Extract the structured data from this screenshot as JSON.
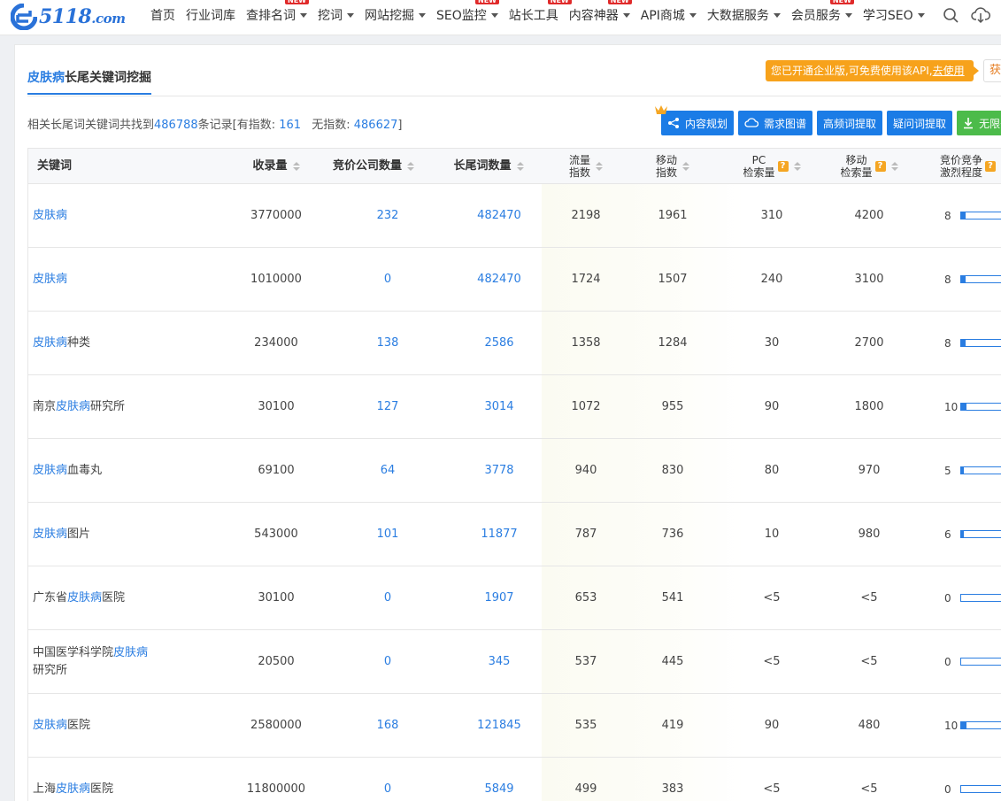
{
  "brand": {
    "logo_text": "5118",
    "logo_suffix": ".com"
  },
  "nav": {
    "items": [
      {
        "label": "首页",
        "caret": false,
        "badge": ""
      },
      {
        "label": "行业词库",
        "caret": false,
        "badge": ""
      },
      {
        "label": "查排名词",
        "caret": true,
        "badge": "NEW"
      },
      {
        "label": "挖词",
        "caret": true,
        "badge": ""
      },
      {
        "label": "网站挖掘",
        "caret": true,
        "badge": ""
      },
      {
        "label": "SEO监控",
        "caret": true,
        "badge": "NEW"
      },
      {
        "label": "站长工具",
        "caret": false,
        "badge": "NEW"
      },
      {
        "label": "内容神器",
        "caret": true,
        "badge": "NEW"
      },
      {
        "label": "API商城",
        "caret": true,
        "badge": ""
      },
      {
        "label": "大数据服务",
        "caret": true,
        "badge": ""
      },
      {
        "label": "会员服务",
        "caret": true,
        "badge": "NEW"
      },
      {
        "label": "学习SEO",
        "caret": true,
        "badge": ""
      }
    ],
    "icons": [
      "search-icon",
      "cloud-download-icon"
    ]
  },
  "tab": {
    "highlight": "皮肤病",
    "rest": "长尾关键词挖掘"
  },
  "promo": {
    "text": "您已开通企业版,可免费使用该API,",
    "link": "去使用"
  },
  "get_button": "获取",
  "summary": {
    "prefix": "相关长尾词关键词共找到",
    "total": "486788",
    "mid": "条记录[有指数:",
    "with_index": "161",
    "mid2": "无指数:",
    "without_index": "486627",
    "suffix": "]"
  },
  "actions": [
    {
      "label": "内容规划",
      "icon": "share-nodes-icon",
      "color": "#1b7ce6"
    },
    {
      "label": "需求图谱",
      "icon": "cloud-icon",
      "color": "#1b7ce6"
    },
    {
      "label": "高频词提取",
      "icon": "",
      "color": "#1b7ce6"
    },
    {
      "label": "疑问词提取",
      "icon": "",
      "color": "#1b7ce6"
    },
    {
      "label": "无限条",
      "icon": "download-icon",
      "color": "#4cbb4a"
    }
  ],
  "table": {
    "headers": {
      "keyword": "关键词",
      "indexed": "收录量",
      "bid_companies": "竞价公司数量",
      "longtail": "长尾词数量",
      "traffic_1": "流量",
      "traffic_2": "指数",
      "mobile_1": "移动",
      "mobile_2": "指数",
      "pc_1": "PC",
      "pc_2": "检索量",
      "msearch_1": "移动",
      "msearch_2": "检索量",
      "comp_1": "竞价竞争",
      "comp_2": "激烈程度"
    },
    "rows": [
      {
        "kw_pre": "",
        "kw_hl": "皮肤病",
        "kw_post": "",
        "indexed": "3770000",
        "bid": "232",
        "longtail": "482470",
        "traffic": "2198",
        "mobile": "1961",
        "pc": "310",
        "msearch": "4200",
        "comp": "8",
        "comp_level": 0.08
      },
      {
        "kw_pre": "",
        "kw_hl": "皮肤病",
        "kw_post": "",
        "indexed": "1010000",
        "bid": "0",
        "longtail": "482470",
        "traffic": "1724",
        "mobile": "1507",
        "pc": "240",
        "msearch": "3100",
        "comp": "8",
        "comp_level": 0.08
      },
      {
        "kw_pre": "",
        "kw_hl": "皮肤病",
        "kw_post": "种类",
        "indexed": "234000",
        "bid": "138",
        "longtail": "2586",
        "traffic": "1358",
        "mobile": "1284",
        "pc": "30",
        "msearch": "2700",
        "comp": "8",
        "comp_level": 0.08
      },
      {
        "kw_pre": "南京",
        "kw_hl": "皮肤病",
        "kw_post": "研究所",
        "indexed": "30100",
        "bid": "127",
        "longtail": "3014",
        "traffic": "1072",
        "mobile": "955",
        "pc": "90",
        "msearch": "1800",
        "comp": "10",
        "comp_level": 0.1
      },
      {
        "kw_pre": "",
        "kw_hl": "皮肤病",
        "kw_post": "血毒丸",
        "indexed": "69100",
        "bid": "64",
        "longtail": "3778",
        "traffic": "940",
        "mobile": "830",
        "pc": "80",
        "msearch": "970",
        "comp": "5",
        "comp_level": 0.05
      },
      {
        "kw_pre": "",
        "kw_hl": "皮肤病",
        "kw_post": "图片",
        "indexed": "543000",
        "bid": "101",
        "longtail": "11877",
        "traffic": "787",
        "mobile": "736",
        "pc": "10",
        "msearch": "980",
        "comp": "6",
        "comp_level": 0.06
      },
      {
        "kw_pre": "广东省",
        "kw_hl": "皮肤病",
        "kw_post": "医院",
        "indexed": "30100",
        "bid": "0",
        "longtail": "1907",
        "traffic": "653",
        "mobile": "541",
        "pc": "<5",
        "msearch": "<5",
        "comp": "0",
        "comp_level": 0
      },
      {
        "kw_pre": "中国医学科学院",
        "kw_hl": "皮肤病",
        "kw_post": "研究所",
        "indexed": "20500",
        "bid": "0",
        "longtail": "345",
        "traffic": "537",
        "mobile": "445",
        "pc": "<5",
        "msearch": "<5",
        "comp": "0",
        "comp_level": 0
      },
      {
        "kw_pre": "",
        "kw_hl": "皮肤病",
        "kw_post": "医院",
        "indexed": "2580000",
        "bid": "168",
        "longtail": "121845",
        "traffic": "535",
        "mobile": "419",
        "pc": "90",
        "msearch": "480",
        "comp": "10",
        "comp_level": 0.1
      },
      {
        "kw_pre": "上海",
        "kw_hl": "皮肤病",
        "kw_post": "医院",
        "indexed": "11800000",
        "bid": "0",
        "longtail": "5849",
        "traffic": "499",
        "mobile": "383",
        "pc": "<5",
        "msearch": "<5",
        "comp": "0",
        "comp_level": 0
      }
    ]
  },
  "colors": {
    "primary": "#2a7de1",
    "promo": "#f7a21b",
    "green": "#4cbb4a",
    "badge": "#e02a2a"
  }
}
